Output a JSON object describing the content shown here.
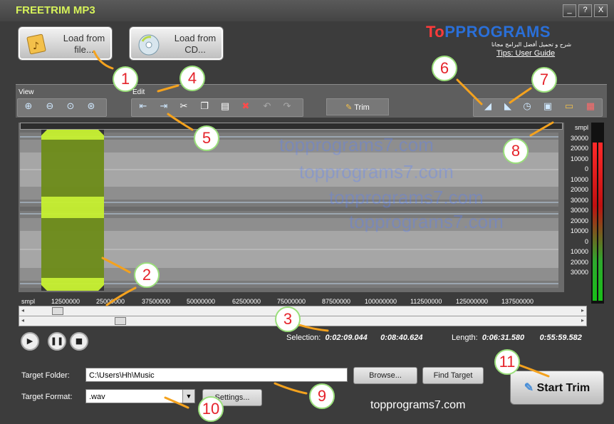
{
  "window": {
    "title": "FREETRIM MP3",
    "controls": [
      "_",
      "?",
      "X"
    ]
  },
  "load": {
    "file_line1": "Load from",
    "file_line2": "file...",
    "cd_line1": "Load from",
    "cd_line2": "CD..."
  },
  "brand": {
    "part1": "To",
    "part2": "PP",
    "part3": "ROGRAMS",
    "sub": "شرح و تحميل أفضل البرامج مجانا",
    "tips": "Tips: User Guide"
  },
  "toolbar": {
    "view_label": "View",
    "edit_label": "Edit",
    "trim_label": "Trim"
  },
  "scale": {
    "vertical_labels": [
      "smpl",
      "30000",
      "20000",
      "10000",
      "0",
      "10000",
      "20000",
      "30000",
      "",
      "30000",
      "20000",
      "10000",
      "0",
      "10000",
      "20000",
      "30000"
    ],
    "horizontal_labels": [
      "smpl",
      "12500000",
      "25000000",
      "37500000",
      "50000000",
      "62500000",
      "75000000",
      "87500000",
      "100000000",
      "112500000",
      "125000000",
      "137500000"
    ]
  },
  "info": {
    "selection_label": "Selection:",
    "selection_start": "0:02:09.044",
    "selection_end": "0:08:40.624",
    "length_label": "Length:",
    "length_value": "0:06:31.580",
    "total": "0:55:59.582"
  },
  "target": {
    "folder_label": "Target Folder:",
    "folder_value": "C:\\Users\\Hh\\Music",
    "browse": "Browse...",
    "find": "Find Target",
    "format_label": "Target Format:",
    "format_value": ".wav",
    "settings": "Settings..."
  },
  "start_trim": "Start Trim",
  "watermark": "topprograms7.com",
  "callouts": [
    "1",
    "2",
    "3",
    "4",
    "5",
    "6",
    "7",
    "8",
    "9",
    "10",
    "11"
  ],
  "colors": {
    "accent": "#bde63a",
    "title": "#d6f25a",
    "callout_text": "#e5232b"
  }
}
